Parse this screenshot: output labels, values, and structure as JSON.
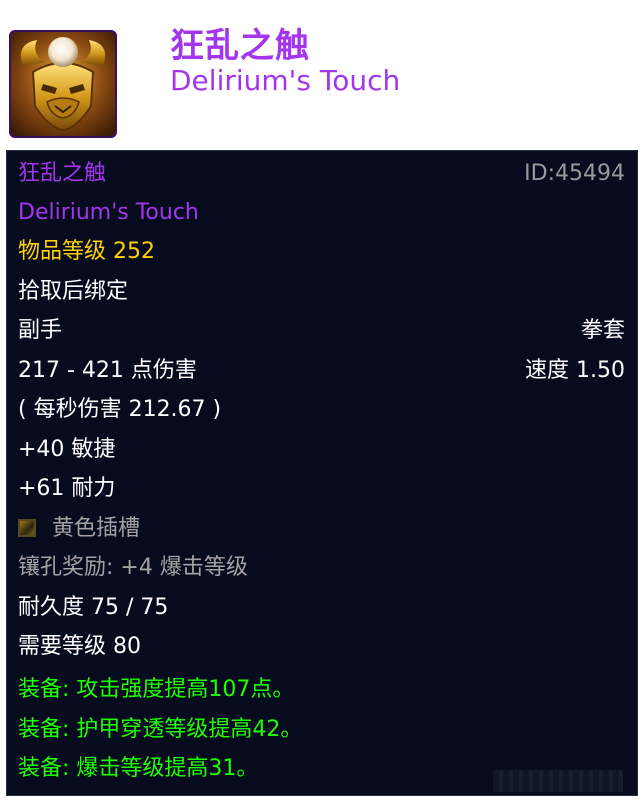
{
  "header": {
    "title_cn": "狂乱之触",
    "title_en": "Delirium's Touch",
    "icon": "golden-mask-icon"
  },
  "tooltip": {
    "name_cn": "狂乱之触",
    "item_id": "ID:45494",
    "name_en": "Delirium's Touch",
    "item_level": "物品等级 252",
    "binding": "拾取后绑定",
    "slot": "副手",
    "weapon_type": "拳套",
    "damage": "217 - 421 点伤害",
    "speed": "速度 1.50",
    "dps": "( 每秒伤害 212.67 )",
    "stat_agility": "+40 敏捷",
    "stat_stamina": "+61 耐力",
    "socket": "黄色插槽",
    "socket_bonus": "镶孔奖励: +4 爆击等级",
    "durability": "耐久度 75 / 75",
    "required_level": "需要等级 80",
    "equip_1": "装备: 攻击强度提高107点。",
    "equip_2": "装备: 护甲穿透等级提高42。",
    "equip_3": "装备: 爆击等级提高31。"
  },
  "colors": {
    "epic": "#a335ee",
    "item_level": "#ffd100",
    "equip": "#1eff00",
    "disabled": "#a3a3a3",
    "background": "#070b1e"
  }
}
